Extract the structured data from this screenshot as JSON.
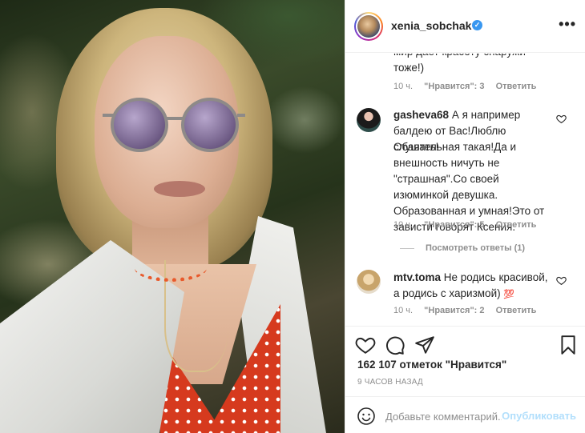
{
  "post": {
    "image_alt": "selfie photo"
  },
  "header": {
    "username": "xenia_sobchak",
    "verified_icon": "verified-badge-icon",
    "more_icon": "more-options-icon"
  },
  "comments": [
    {
      "partial_text": "Мир дает красоту снаружи тоже!)",
      "line1": "мир дает красоту снаружи",
      "line2": "тоже!)",
      "time": "10 ч.",
      "likes": "\"Нравится\": 3",
      "reply": "Ответить"
    },
    {
      "username": "gasheva68",
      "lines": [
        "А я например",
        "балдею от Вас!Люблю слушать!",
        "Обаятельная такая!Да и",
        "внешность ничуть не",
        "\"страшная\".Со своей",
        "изюминкой девушка.",
        "Образованная и умная!Это от",
        "зависти говорят Ксения."
      ],
      "time": "10 ч.",
      "likes": "\"Нравится\": 5",
      "reply": "Ответить",
      "view_replies": "Посмотреть ответы (1)"
    },
    {
      "username": "mtv.toma",
      "line1": "Не родись красивой,",
      "line2": "а родись с харизмой)",
      "emoji": "💯",
      "time": "10 ч.",
      "likes": "\"Нравится\": 2",
      "reply": "Ответить"
    }
  ],
  "actions": {
    "likes_text": "162 107 отметок \"Нравится\"",
    "time_ago": "9 ЧАСОВ НАЗАД"
  },
  "add_comment": {
    "placeholder": "Добавьте комментарий...",
    "publish_label": "Опубликовать"
  },
  "colors": {
    "verified": "#3897f0",
    "muted": "#8e8e8e",
    "publish_disabled": "#b2dffc"
  }
}
